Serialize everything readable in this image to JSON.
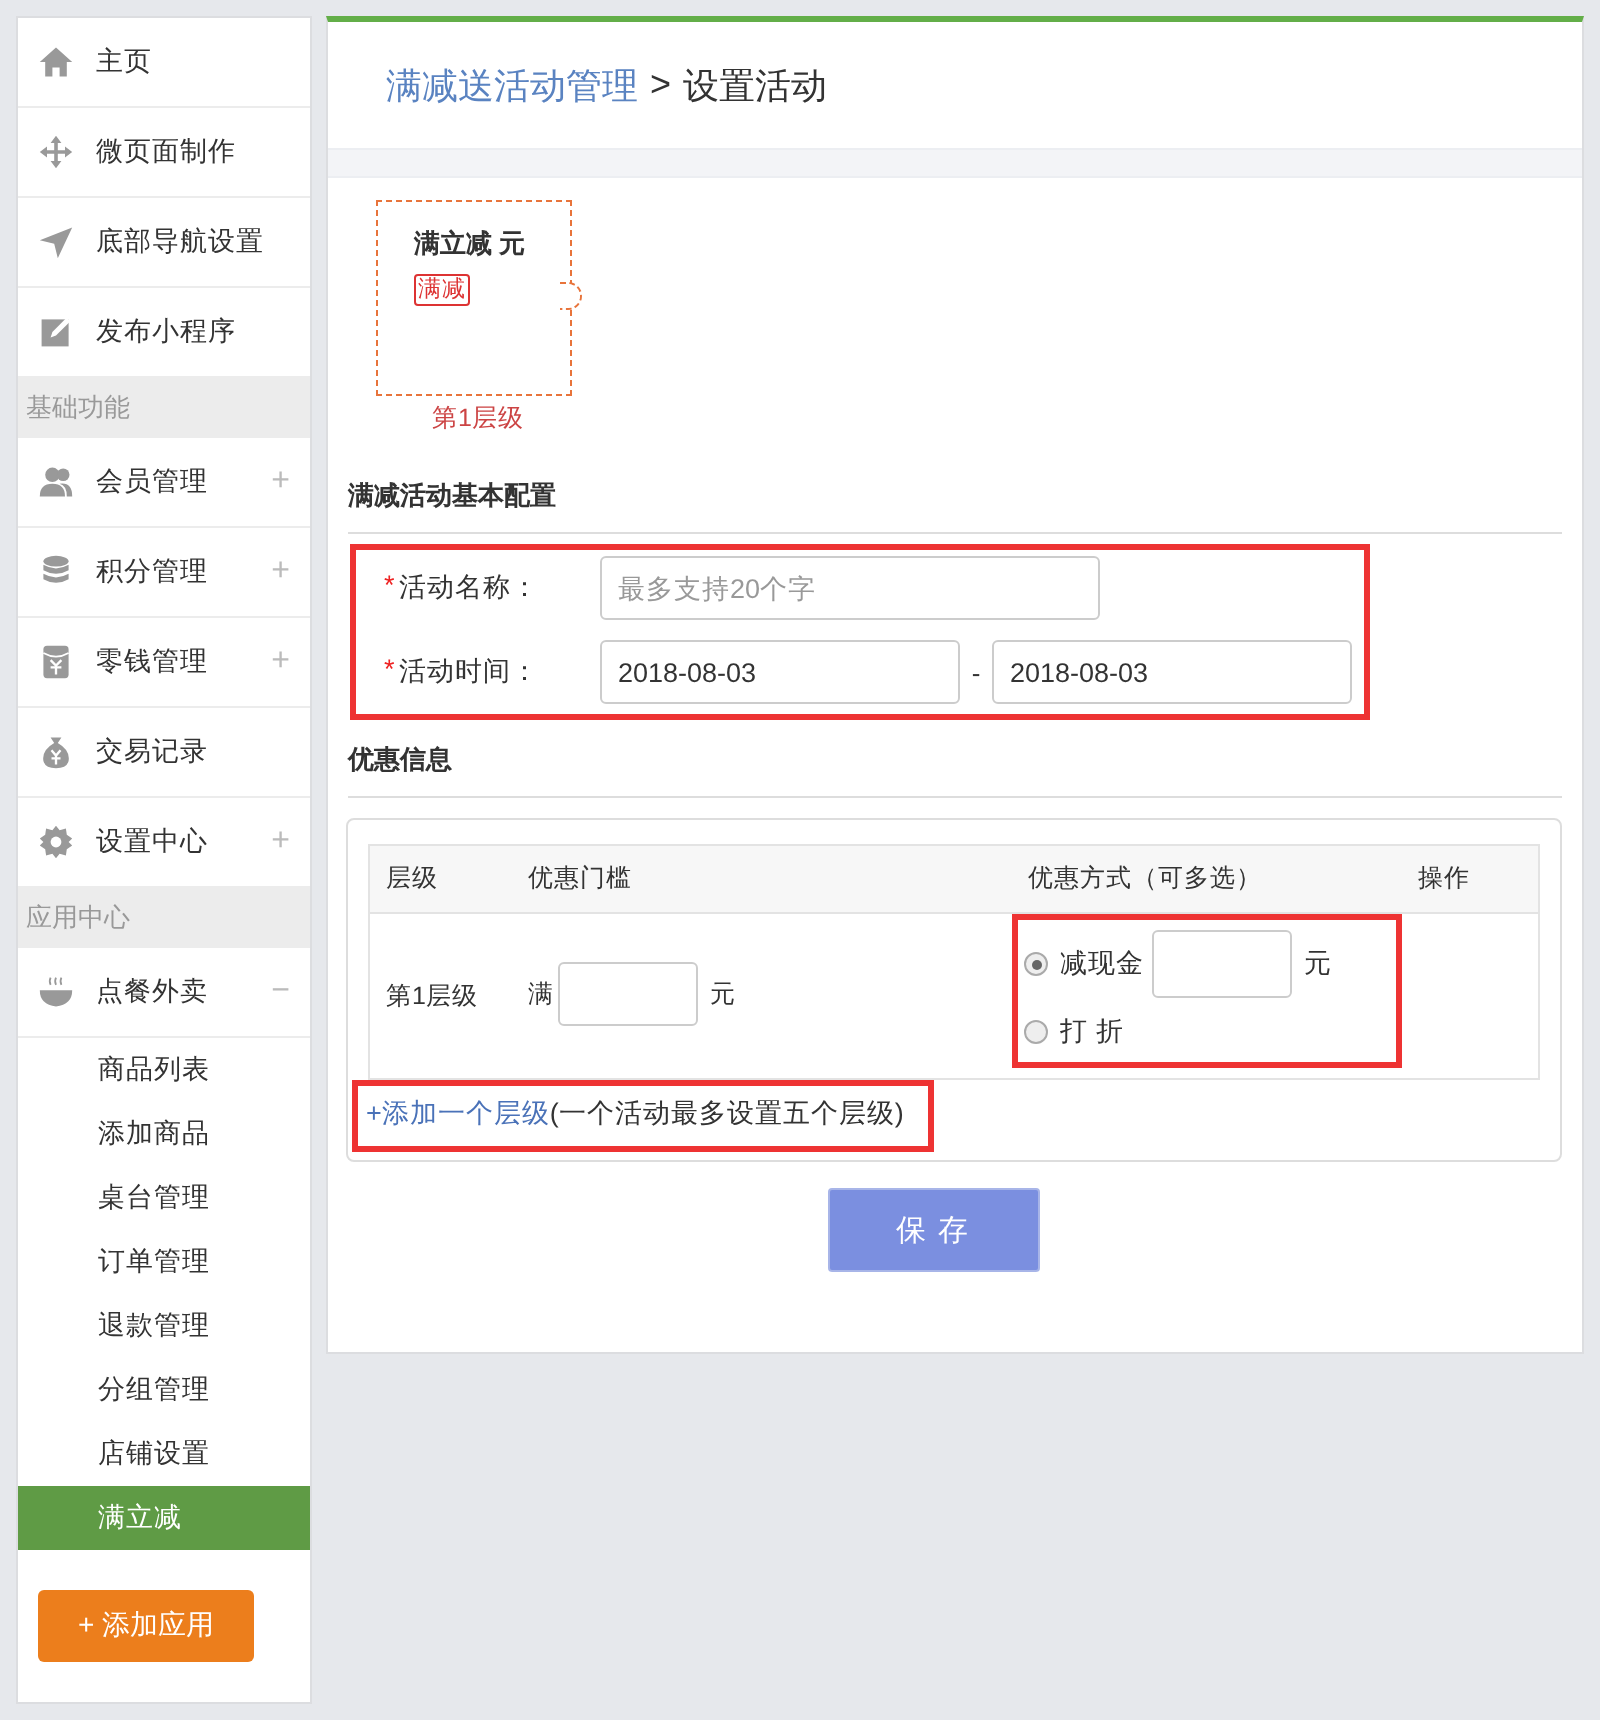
{
  "sidebar": {
    "sections": [
      {
        "items": [
          {
            "label": "主页",
            "selected": false
          },
          {
            "label": "微页面制作",
            "selected": false
          },
          {
            "label": "底部导航设置",
            "selected": false
          },
          {
            "label": "发布小程序",
            "selected": false
          }
        ]
      },
      {
        "title": "基础功能",
        "items": [
          {
            "label": "会员管理",
            "expander": "+",
            "selected": false
          },
          {
            "label": "积分管理",
            "expander": "+",
            "selected": false
          },
          {
            "label": "零钱管理",
            "expander": "+",
            "selected": false
          },
          {
            "label": "交易记录",
            "selected": false
          },
          {
            "label": "设置中心",
            "expander": "+",
            "selected": false
          }
        ]
      },
      {
        "title": "应用中心",
        "items": [
          {
            "label": "点餐外卖",
            "expander": "−",
            "selected": false,
            "children": [
              {
                "label": "商品列表",
                "selected": false
              },
              {
                "label": "添加商品",
                "selected": false
              },
              {
                "label": "桌台管理",
                "selected": false
              },
              {
                "label": "订单管理",
                "selected": false
              },
              {
                "label": "退款管理",
                "selected": false
              },
              {
                "label": "分组管理",
                "selected": false
              },
              {
                "label": "店铺设置",
                "selected": false
              },
              {
                "label": "满立减",
                "selected": true
              }
            ]
          }
        ]
      }
    ],
    "add_button": "+ 添加应用"
  },
  "breadcrumb": {
    "link": "满减送活动管理",
    "separator": ">",
    "current": "设置活动"
  },
  "preview": {
    "title": "满立减 元",
    "tag": "满减",
    "caption": "第1层级"
  },
  "basic": {
    "title": "满减活动基本配置",
    "required_mark": "*",
    "name_label": "活动名称：",
    "name_placeholder": "最多支持20个字",
    "time_label": "活动时间：",
    "start": "2018-08-03",
    "dash": "-",
    "end": "2018-08-03"
  },
  "discount": {
    "title": "优惠信息",
    "columns": [
      "层级",
      "优惠门槛",
      "优惠方式（可多选）",
      "操作"
    ],
    "rows": [
      {
        "level": "第1层级",
        "threshold_prefix": "满",
        "threshold_unit": "元",
        "options": [
          {
            "kind": "amount",
            "label": "减现金",
            "unit": "元",
            "selected": true
          },
          {
            "kind": "plain",
            "label": "打 折",
            "selected": false
          }
        ]
      }
    ],
    "add_link": "+添加一个层级",
    "add_note": "(一个活动最多设置五个层级)"
  },
  "save_button": "保 存"
}
